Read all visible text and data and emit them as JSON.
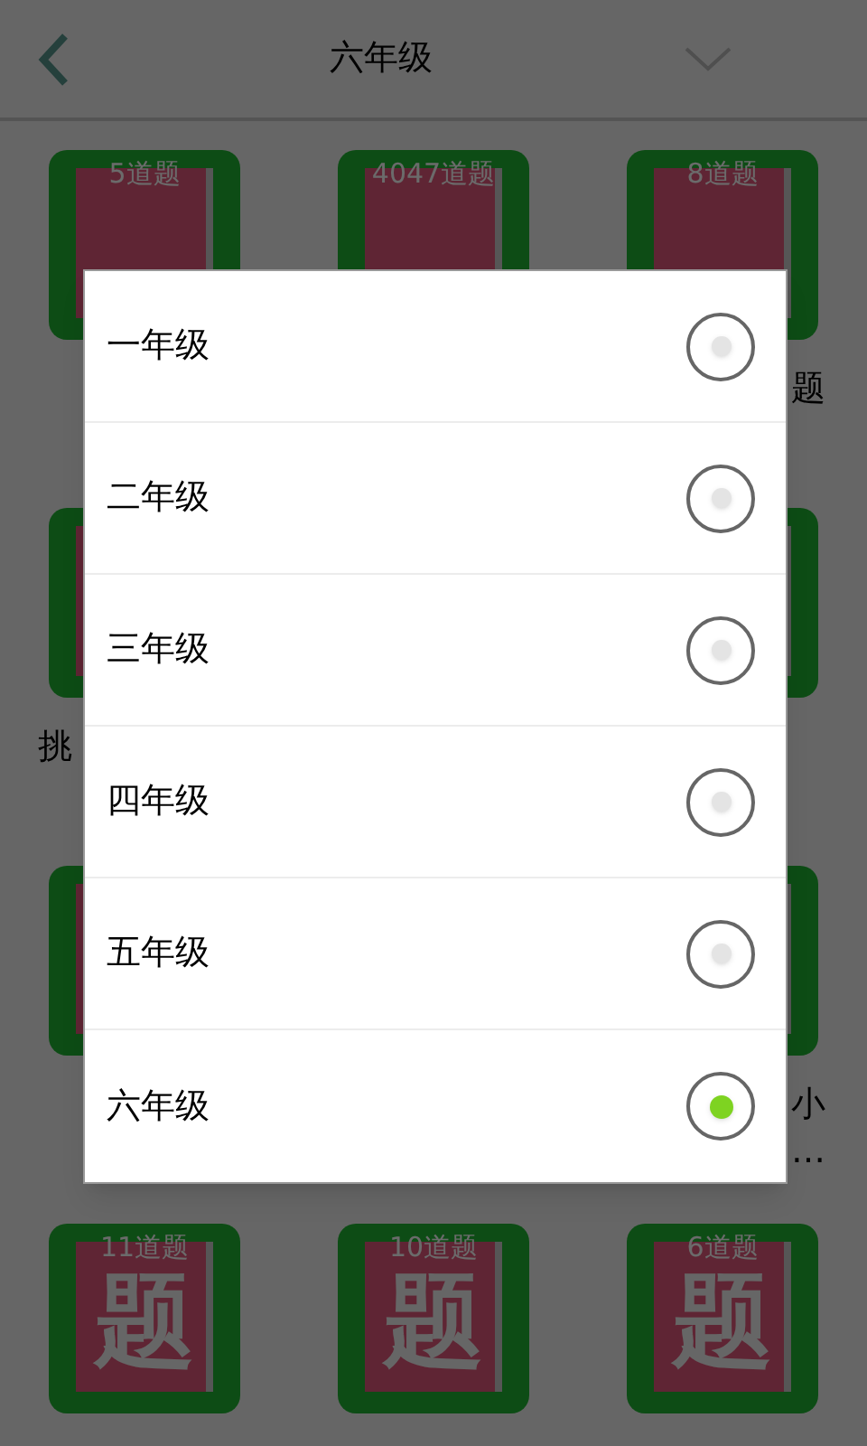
{
  "header": {
    "title": "六年级"
  },
  "tile_rows": [
    [
      {
        "count": "5道题"
      },
      {
        "count": "4047道题"
      },
      {
        "count": "8道题",
        "label": "题"
      }
    ],
    [
      {
        "label": "挑"
      },
      {}
    ],
    [
      {},
      {
        "label": "小",
        "label_2": "…"
      }
    ],
    [
      {
        "count": "11道题",
        "glyph": "题"
      },
      {
        "count": "10道题",
        "glyph": "题"
      },
      {
        "count": "6道题",
        "glyph": "题"
      }
    ]
  ],
  "dialog": {
    "options": [
      {
        "label": "一年级",
        "selected": false
      },
      {
        "label": "二年级",
        "selected": false
      },
      {
        "label": "三年级",
        "selected": false
      },
      {
        "label": "四年级",
        "selected": false
      },
      {
        "label": "五年级",
        "selected": false
      },
      {
        "label": "六年级",
        "selected": true
      }
    ]
  }
}
